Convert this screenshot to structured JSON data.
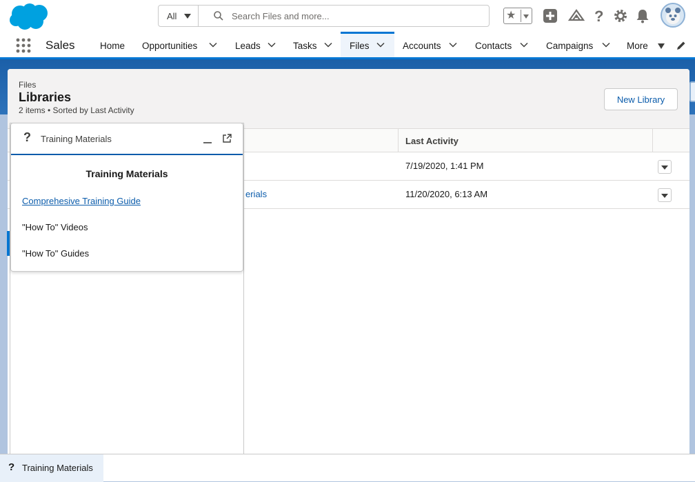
{
  "header": {
    "search_scope": "All",
    "search_placeholder": "Search Files and more...",
    "icons": [
      "salesforce-logo",
      "search-icon",
      "favorites-star-icon",
      "add-icon",
      "trailhead-icon",
      "help-icon",
      "setup-gear-icon",
      "notifications-bell-icon",
      "user-avatar"
    ]
  },
  "nav": {
    "app_name": "Sales",
    "items": [
      {
        "label": "Home"
      },
      {
        "label": "Opportunities"
      },
      {
        "label": "Leads"
      },
      {
        "label": "Tasks"
      },
      {
        "label": "Files"
      },
      {
        "label": "Accounts"
      },
      {
        "label": "Contacts"
      },
      {
        "label": "Campaigns"
      },
      {
        "label": "More"
      }
    ],
    "active": "Files"
  },
  "list": {
    "breadcrumb": "Files",
    "title": "Libraries",
    "meta": "2 items • Sorted by Last Activity",
    "new_button": "New Library",
    "columns": {
      "last_activity": "Last Activity"
    },
    "rows": [
      {
        "name": "",
        "last_activity": "7/19/2020, 1:41 PM"
      },
      {
        "name": "erials",
        "last_activity": "11/20/2020, 6:13 AM"
      }
    ]
  },
  "panel": {
    "title": "Training Materials",
    "heading": "Training Materials",
    "link": "Comprehesive Training Guide",
    "items": [
      "\"How To\" Videos",
      "\"How To\" Guides"
    ]
  },
  "utility": {
    "label": "Training Materials"
  },
  "colors": {
    "brand": "#0176d3",
    "link": "#0b5cab",
    "logo": "#00a1e0"
  }
}
